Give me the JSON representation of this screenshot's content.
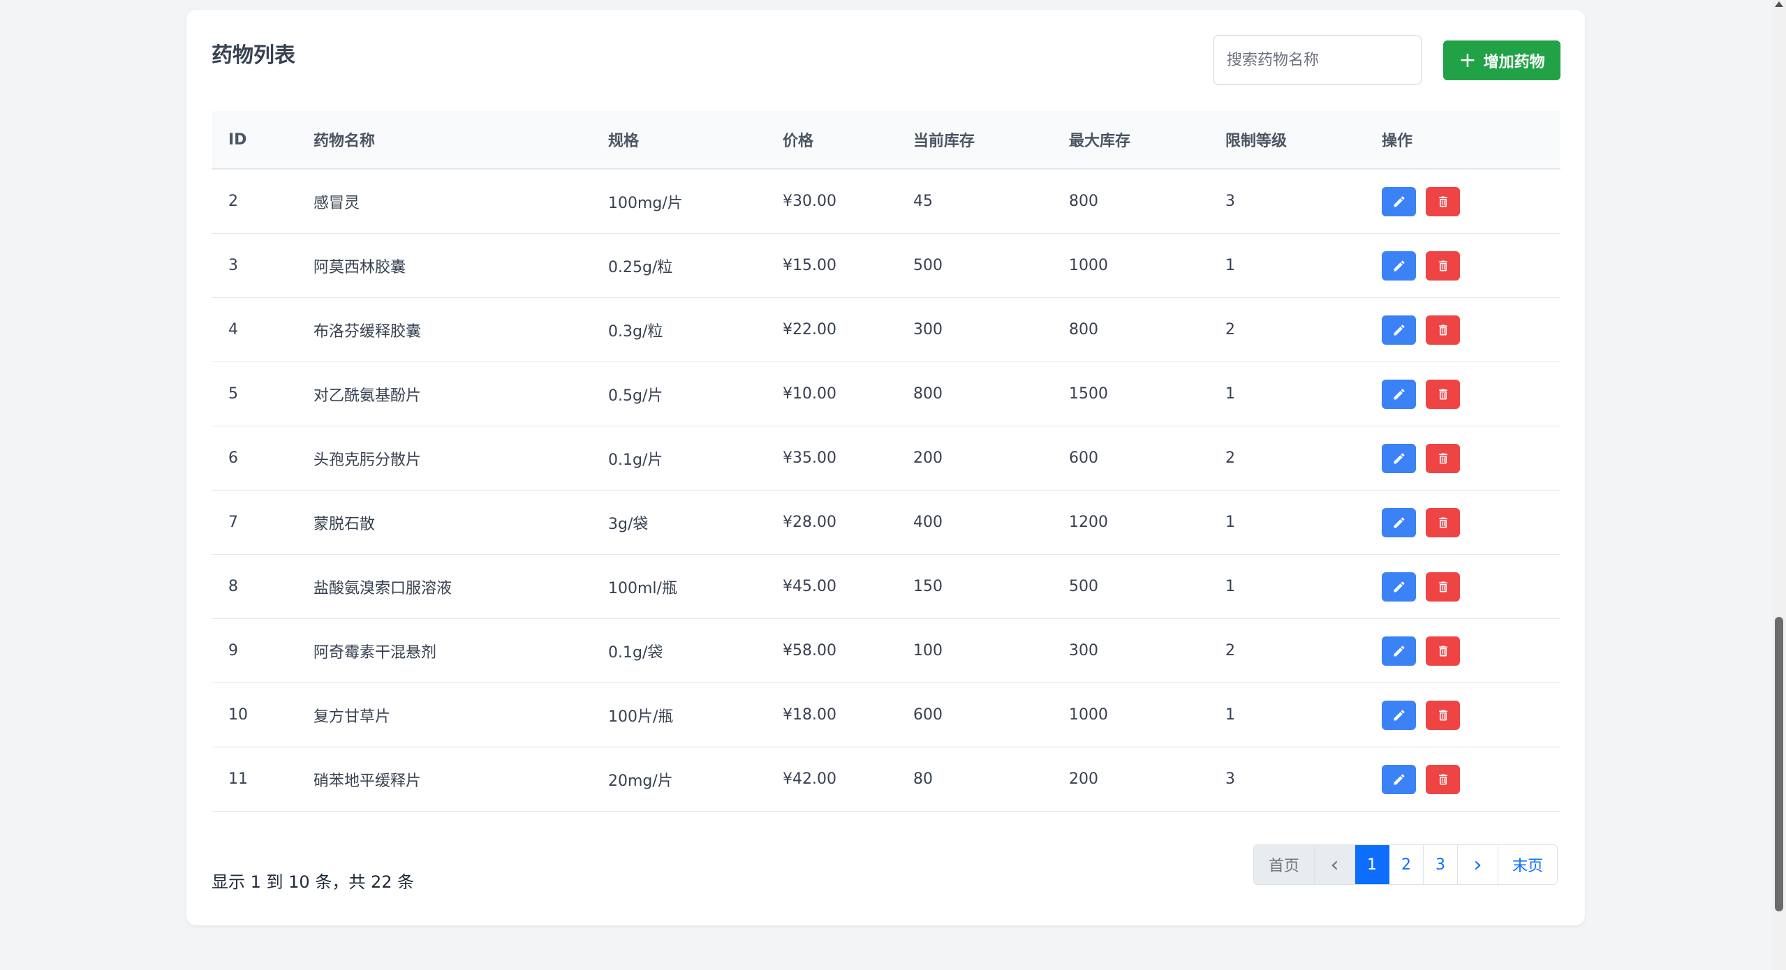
{
  "page_title": "药物列表",
  "search": {
    "placeholder": "搜索药物名称"
  },
  "add_button": {
    "label": "增加药物",
    "icon": "plus-icon"
  },
  "table": {
    "headers": [
      "ID",
      "药物名称",
      "规格",
      "价格",
      "当前库存",
      "最大库存",
      "限制等级",
      "操作"
    ],
    "rows": [
      {
        "id": "2",
        "name": "感冒灵",
        "spec": "100mg/片",
        "price": "¥30.00",
        "stock": "45",
        "max_stock": "800",
        "level": "3"
      },
      {
        "id": "3",
        "name": "阿莫西林胶囊",
        "spec": "0.25g/粒",
        "price": "¥15.00",
        "stock": "500",
        "max_stock": "1000",
        "level": "1"
      },
      {
        "id": "4",
        "name": "布洛芬缓释胶囊",
        "spec": "0.3g/粒",
        "price": "¥22.00",
        "stock": "300",
        "max_stock": "800",
        "level": "2"
      },
      {
        "id": "5",
        "name": "对乙酰氨基酚片",
        "spec": "0.5g/片",
        "price": "¥10.00",
        "stock": "800",
        "max_stock": "1500",
        "level": "1"
      },
      {
        "id": "6",
        "name": "头孢克肟分散片",
        "spec": "0.1g/片",
        "price": "¥35.00",
        "stock": "200",
        "max_stock": "600",
        "level": "2"
      },
      {
        "id": "7",
        "name": "蒙脱石散",
        "spec": "3g/袋",
        "price": "¥28.00",
        "stock": "400",
        "max_stock": "1200",
        "level": "1"
      },
      {
        "id": "8",
        "name": "盐酸氨溴索口服溶液",
        "spec": "100ml/瓶",
        "price": "¥45.00",
        "stock": "150",
        "max_stock": "500",
        "level": "1"
      },
      {
        "id": "9",
        "name": "阿奇霉素干混悬剂",
        "spec": "0.1g/袋",
        "price": "¥58.00",
        "stock": "100",
        "max_stock": "300",
        "level": "2"
      },
      {
        "id": "10",
        "name": "复方甘草片",
        "spec": "100片/瓶",
        "price": "¥18.00",
        "stock": "600",
        "max_stock": "1000",
        "level": "1"
      },
      {
        "id": "11",
        "name": "硝苯地平缓释片",
        "spec": "20mg/片",
        "price": "¥42.00",
        "stock": "80",
        "max_stock": "200",
        "level": "3"
      }
    ],
    "row_actions": [
      {
        "name": "edit",
        "icon": "pencil-icon",
        "color": "#3b82f6"
      },
      {
        "name": "delete",
        "icon": "trash-icon",
        "color": "#ef4444"
      }
    ]
  },
  "summary": "显示 1 到 10 条，共 22 条",
  "pagination": {
    "items": [
      {
        "label": "首页",
        "kind": "first",
        "state": "disabled"
      },
      {
        "label": "‹",
        "kind": "prev",
        "state": "disabled",
        "icon": "chevron-left-icon"
      },
      {
        "label": "1",
        "kind": "page",
        "state": "active"
      },
      {
        "label": "2",
        "kind": "page",
        "state": "normal"
      },
      {
        "label": "3",
        "kind": "page",
        "state": "normal"
      },
      {
        "label": "›",
        "kind": "next",
        "state": "normal",
        "icon": "chevron-right-icon"
      },
      {
        "label": "末页",
        "kind": "last",
        "state": "normal"
      }
    ],
    "current_page": 1
  },
  "colors": {
    "background": "#f3f4f6",
    "accent_green": "#22a246",
    "edit_blue": "#3b82f6",
    "delete_red": "#ef4444",
    "pagination_active": "#0d6efd"
  }
}
